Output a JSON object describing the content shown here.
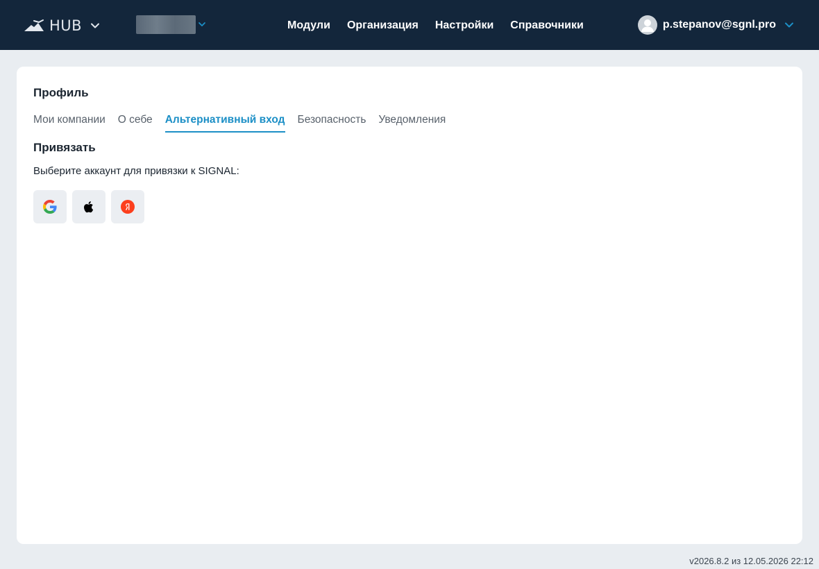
{
  "header": {
    "logo_text": "HUB",
    "nav": [
      {
        "label": "Модули"
      },
      {
        "label": "Организация"
      },
      {
        "label": "Настройки"
      },
      {
        "label": "Справочники"
      }
    ],
    "user_email": "p.stepanov@sgnl.pro"
  },
  "profile": {
    "title": "Профиль",
    "tabs": [
      {
        "label": "Мои компании",
        "active": false
      },
      {
        "label": "О себе",
        "active": false
      },
      {
        "label": "Альтернативный вход",
        "active": true
      },
      {
        "label": "Безопасность",
        "active": false
      },
      {
        "label": "Уведомления",
        "active": false
      }
    ],
    "section_title": "Привязать",
    "section_desc": "Выберите аккаунт для привязки к SIGNAL:",
    "providers": [
      {
        "icon": "google-icon"
      },
      {
        "icon": "apple-icon"
      },
      {
        "icon": "yandex-icon"
      }
    ]
  },
  "footer": {
    "version": "v2026.8.2 из 12.05.2026 22:12"
  },
  "colors": {
    "header_bg": "#13263b",
    "page_bg": "#e9edf1",
    "accent": "#1c8fc6",
    "provider_bg": "#ebeef2"
  }
}
